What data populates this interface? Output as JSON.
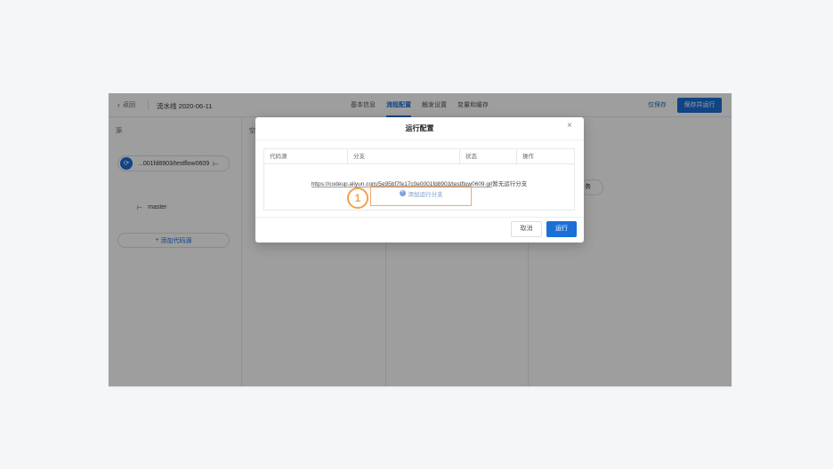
{
  "header": {
    "back_label": "返回",
    "pipeline_name": "流水线 2020-06-11",
    "tabs": [
      {
        "label": "基本信息"
      },
      {
        "label": "流程配置"
      },
      {
        "label": "触发设置"
      },
      {
        "label": "变量和缓存"
      }
    ],
    "active_tab": "流程配置",
    "save_label": "仅保存",
    "save_run_label": "保存并运行"
  },
  "canvas": {
    "source_col_label": "源",
    "build_col_label": "空",
    "repo_name": "...001fd8903/testflow0609",
    "branch_name": "master",
    "add_repo_label": "添加代码源",
    "task_label": "务"
  },
  "modal": {
    "title": "运行配置",
    "columns": [
      "代码源",
      "分支",
      "状态",
      "操作"
    ],
    "row_url": "https://codeup.aliyun.com/5e95bf7fe17c0e0001fd8903/testflow0609.git",
    "row_message": "暂无运行分支",
    "add_branch_label": "添加运行分支",
    "step_number": "1",
    "cancel_label": "取消",
    "run_label": "运行"
  },
  "colors": {
    "primary": "#1b6fd6",
    "highlight": "#f0a24e"
  }
}
